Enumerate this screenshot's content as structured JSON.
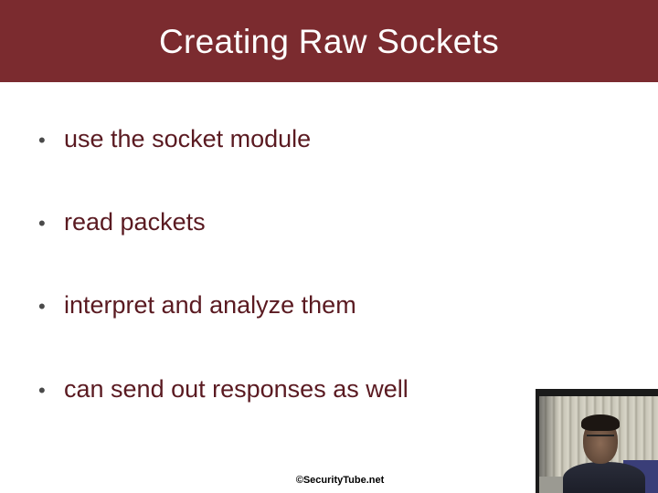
{
  "slide": {
    "title": "Creating Raw Sockets",
    "bullets": [
      "use the socket module",
      "read packets",
      "interpret and analyze them",
      "can send out responses as well"
    ],
    "bullet_symbol": "•",
    "footer": "©SecurityTube.net"
  },
  "colors": {
    "title_bar": "#7b2b2f",
    "title_text": "#ffffff",
    "bullet_text": "#5a1a21",
    "background": "#ffffff"
  },
  "webcam": {
    "icon": "presenter-video-feed"
  }
}
